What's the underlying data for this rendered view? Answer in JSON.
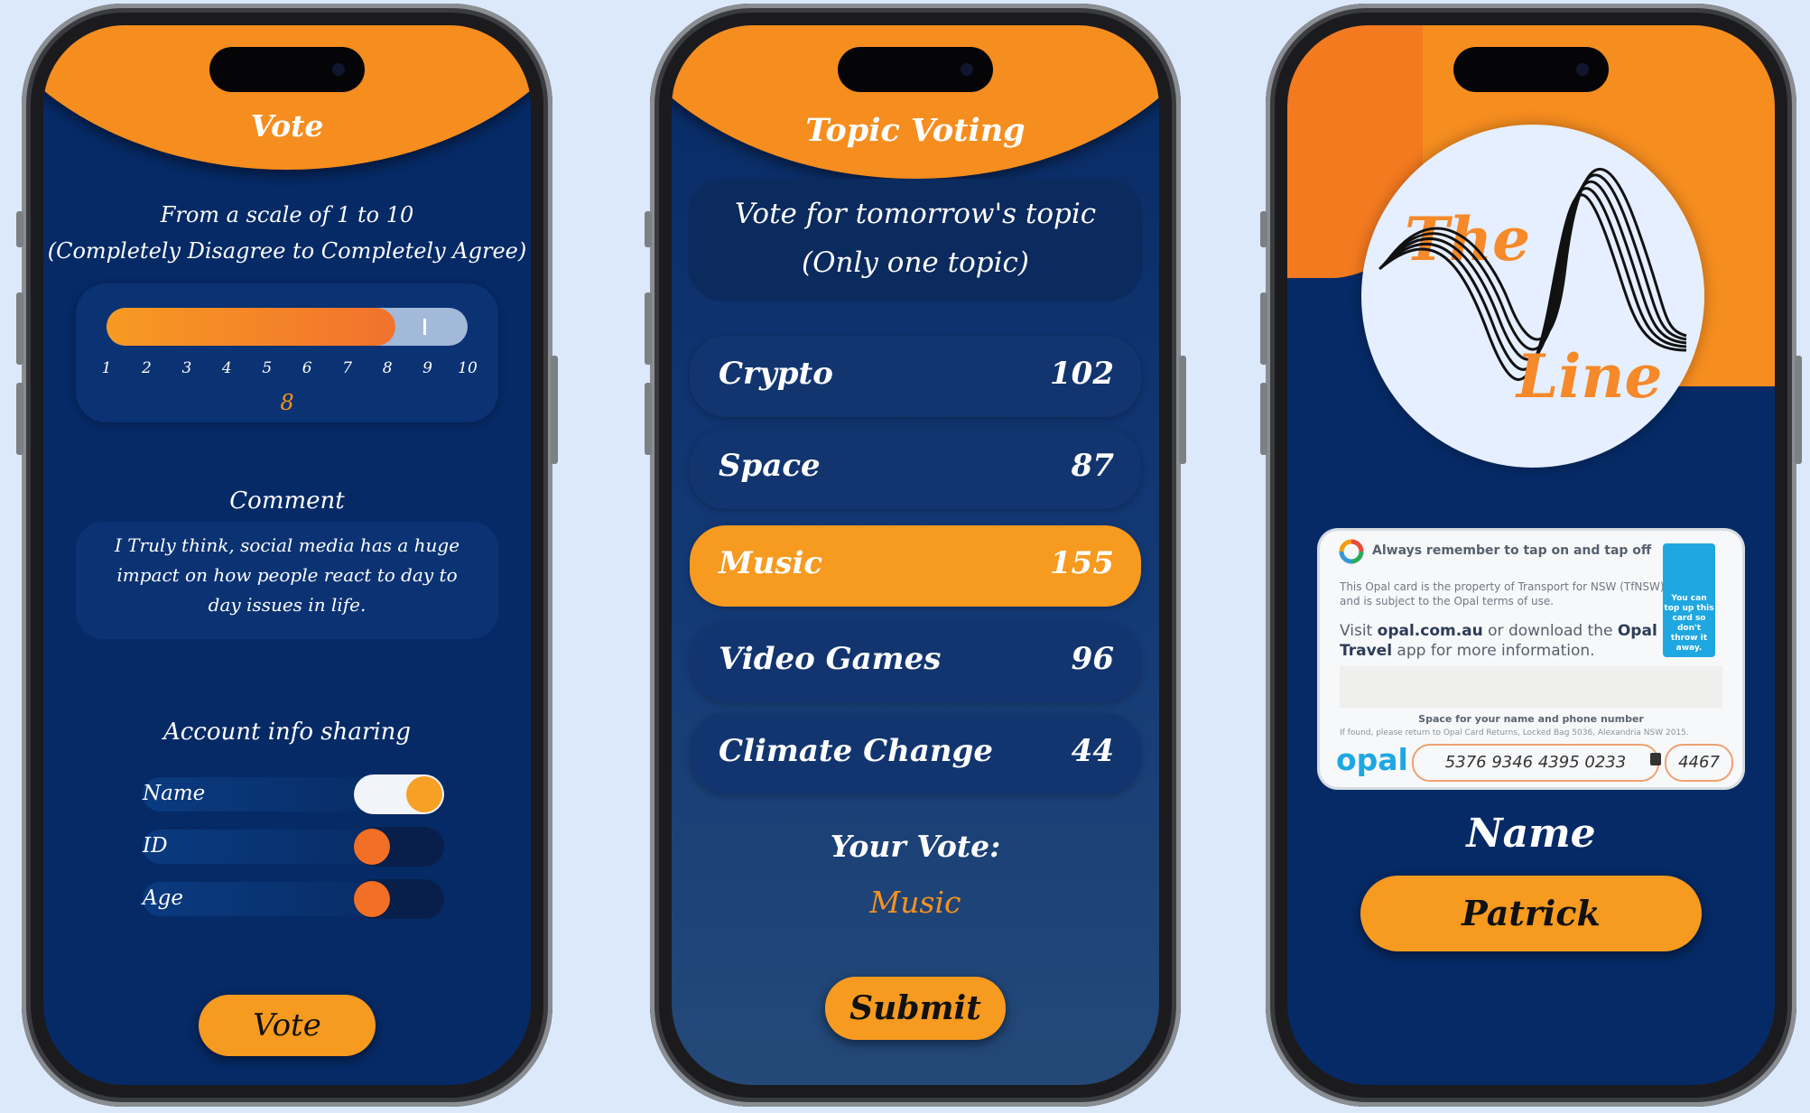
{
  "vote_screen": {
    "title": "Vote",
    "intro_line1": "From a scale of 1 to 10",
    "intro_line2": "(Completely Disagree to Completely Agree)",
    "scale": {
      "ticks": [
        "1",
        "2",
        "3",
        "4",
        "5",
        "6",
        "7",
        "8",
        "9",
        "10"
      ],
      "value": "8",
      "fill_fraction": 0.8
    },
    "comment_label": "Comment",
    "comment_text": "I Truly think, social media has a huge impact on how people react to day to day issues in life.",
    "sharing_label": "Account info sharing",
    "toggles": [
      {
        "label": "Name",
        "on": true
      },
      {
        "label": "ID",
        "on": false
      },
      {
        "label": "Age",
        "on": false
      }
    ],
    "vote_button": "Vote",
    "colors": {
      "accent": "#f69a20",
      "background": "#062a66"
    }
  },
  "topic_screen": {
    "title": "Topic Voting",
    "prompt_line1": "Vote for tomorrow's topic",
    "prompt_line2": "(Only one topic)",
    "topics": [
      {
        "name": "Crypto",
        "count": "102",
        "selected": false
      },
      {
        "name": "Space",
        "count": "87",
        "selected": false
      },
      {
        "name": "Music",
        "count": "155",
        "selected": true
      },
      {
        "name": "Video Games",
        "count": "96",
        "selected": false
      },
      {
        "name": "Climate Change",
        "count": "44",
        "selected": false
      }
    ],
    "your_vote_label": "Your Vote:",
    "your_vote_value": "Music",
    "submit_button": "Submit"
  },
  "profile_screen": {
    "logo_word1": "The",
    "logo_word2": "Line",
    "opal_card": {
      "tap_reminder": "Always remember to tap on and tap off",
      "property_text": "This Opal card is the property of Transport for NSW (TfNSW) and is subject to the Opal terms of use.",
      "visit_prefix": "Visit ",
      "visit_site": "opal.com.au",
      "visit_middle": " or download the ",
      "visit_app": "Opal Travel",
      "visit_suffix": " app for more information.",
      "blue_panel_text": "You can top up this card so don't throw it away.",
      "space_text": "Space for your name and phone number",
      "return_text": "If found, please return to Opal Card Returns, Locked Bag 5036, Alexandria NSW 2015.",
      "brand": "opal",
      "card_number": "5376 9346 4395 0233",
      "pin": "4467"
    },
    "name_label": "Name",
    "name_value": "Patrick"
  }
}
